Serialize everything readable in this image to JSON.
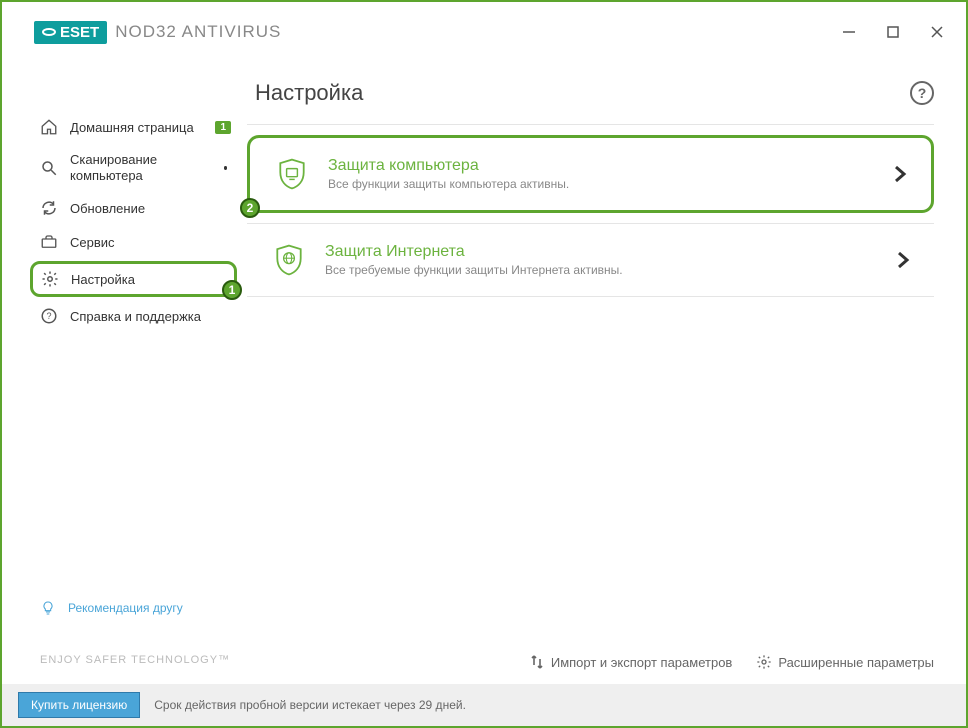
{
  "titlebar": {
    "brand": "ESET",
    "product": "NOD32 ANTIVIRUS"
  },
  "sidebar": {
    "items": [
      {
        "label": "Домашняя страница",
        "badge": "1"
      },
      {
        "label": "Сканирование компьютера"
      },
      {
        "label": "Обновление"
      },
      {
        "label": "Сервис"
      },
      {
        "label": "Настройка",
        "marker": "1"
      },
      {
        "label": "Справка и поддержка"
      }
    ],
    "recommend": "Рекомендация другу",
    "tagline": "ENJOY SAFER TECHNOLOGY™"
  },
  "main": {
    "title": "Настройка",
    "cards": [
      {
        "title": "Защита компьютера",
        "subtitle": "Все функции защиты компьютера активны.",
        "marker": "2"
      },
      {
        "title": "Защита Интернета",
        "subtitle": "Все требуемые функции защиты Интернета активны."
      }
    ]
  },
  "footer": {
    "import_export": "Импорт и экспорт параметров",
    "advanced": "Расширенные параметры"
  },
  "statusbar": {
    "buy": "Купить лицензию",
    "trial": "Срок действия пробной версии истекает через 29 дней."
  }
}
